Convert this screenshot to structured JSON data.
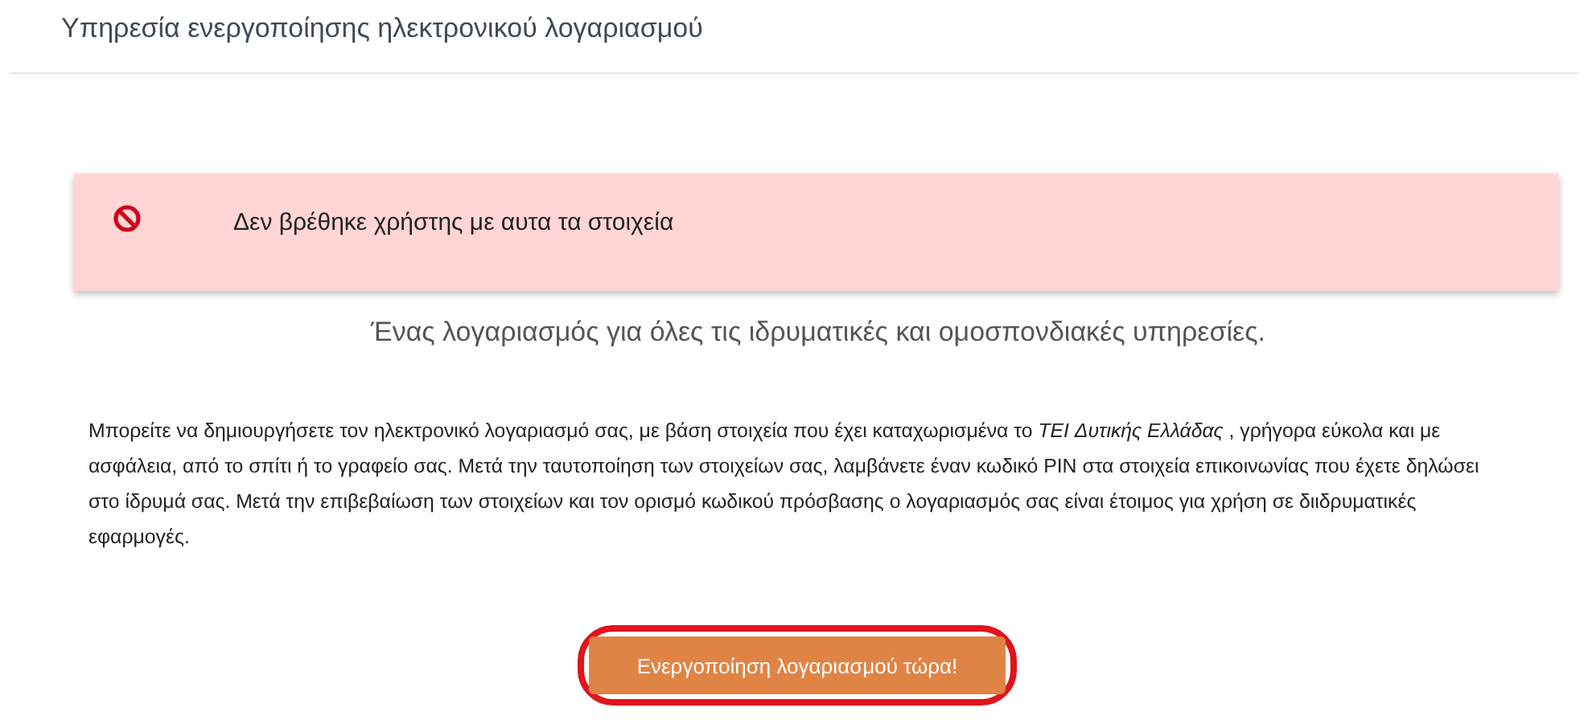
{
  "page_title": "Υπηρεσία ενεργοποίησης ηλεκτρονικού λογαριασμού",
  "alert": {
    "kind": "error",
    "message": "Δεν βρέθηκε χρήστης με αυτα τα στοιχεία"
  },
  "subtitle": "Ένας λογαριασμός για όλες τις ιδρυματικές και ομοσπονδιακές υπηρεσίες.",
  "description": "Μπορείτε να δημιουργήσετε τον ηλεκτρονικό λογαριασμό σας, με βάση στοιχεία που έχει καταχωρισμένα το *TEI Δυτικής Ελλάδας* , γρήγορα εύκολα και με ασφάλεια, από το σπίτι ή το γραφείο σας. Μετά την ταυτοποίηση των στοιχείων σας, λαμβάνετε έναν κωδικό PIN στα στοιχεία επικοινωνίας που έχετε δηλώσει στο ίδρυμά σας. Μετά την επιβεβαίωση των στοιχείων και τον ορισμό κωδικού πρόσβασης ο λογαριασμός σας είναι έτοιμος για χρήση σε διιδρυματικές εφαρμογές.",
  "activate_button": {
    "label": "Ενεργοποίηση λογαριασμού τώρα!",
    "highlighted": true
  }
}
